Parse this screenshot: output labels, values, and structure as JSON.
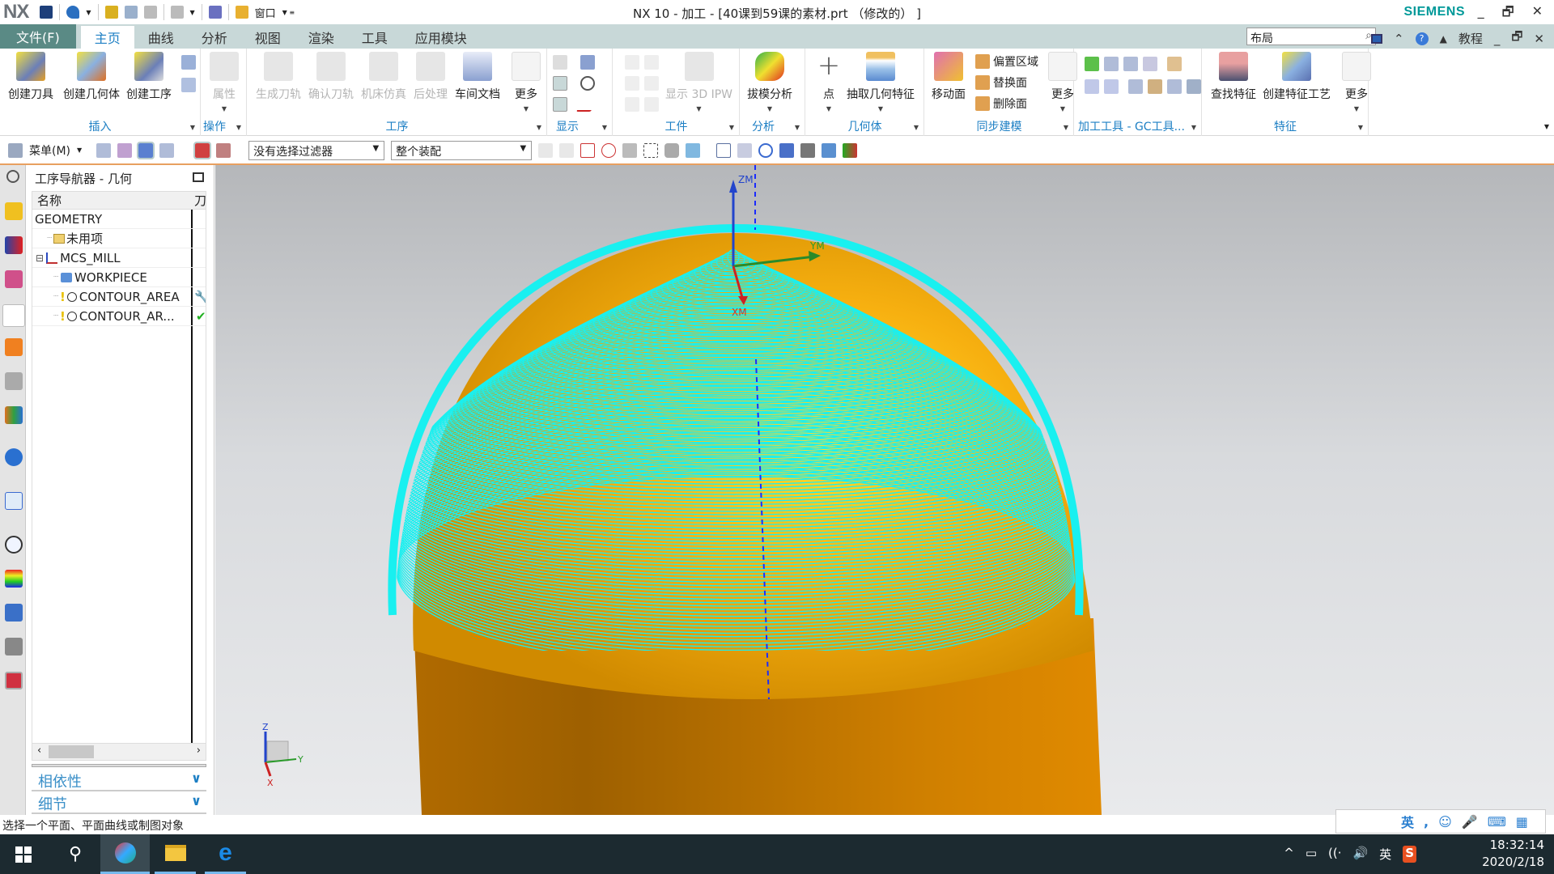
{
  "app": {
    "logo": "NX",
    "window_title": "NX 10 - 加工 - [40课到59课的素材.prt （修改的） ]",
    "brand": "SIEMENS",
    "quick_access": {
      "window_menu_label": "窗口"
    }
  },
  "window_controls": {
    "minimize": "_",
    "restore": "🗗",
    "close": "✕"
  },
  "tabs": {
    "file": "文件(F)",
    "items": [
      "主页",
      "曲线",
      "分析",
      "视图",
      "渲染",
      "工具",
      "应用模块"
    ],
    "active": "主页"
  },
  "command_search": {
    "value": "布局",
    "search_icon": "magnifier-icon"
  },
  "tab_right": {
    "help": "?",
    "tutorial": "教程"
  },
  "ribbon": {
    "groups": [
      {
        "label": "插入",
        "buttons": [
          "创建刀具",
          "创建几何体",
          "创建工序"
        ]
      },
      {
        "label": "操作",
        "buttons": [
          "属性"
        ]
      },
      {
        "label": "工序",
        "buttons": [
          "生成刀轨",
          "确认刀轨",
          "机床仿真",
          "后处理",
          "车间文档",
          "更多"
        ]
      },
      {
        "label": "显示",
        "buttons": []
      },
      {
        "label": "工件",
        "buttons": [
          "显示 3D IPW"
        ]
      },
      {
        "label": "分析",
        "buttons": [
          "拔模分析"
        ]
      },
      {
        "label": "几何体",
        "buttons": [
          "点",
          "抽取几何特征"
        ]
      },
      {
        "label": "同步建模",
        "buttons": [
          "移动面",
          "更多"
        ],
        "small_buttons": [
          "偏置区域",
          "替换面",
          "删除面"
        ]
      },
      {
        "label": "加工工具 - GC工具...",
        "buttons": []
      },
      {
        "label": "特征",
        "buttons": [
          "查找特征",
          "创建特征工艺",
          "更多"
        ]
      }
    ]
  },
  "toolbar2": {
    "menu_label": "菜单(M)",
    "filter_select": "没有选择过滤器",
    "assembly_select": "整个装配"
  },
  "navigator": {
    "title": "工序导航器 - 几何",
    "columns": [
      "名称",
      "刀"
    ],
    "rows": [
      {
        "name": "GEOMETRY",
        "level": 0,
        "icon": "",
        "status": ""
      },
      {
        "name": "未用项",
        "level": 1,
        "icon": "unused-folder-icon",
        "status": ""
      },
      {
        "name": "MCS_MILL",
        "level": 1,
        "icon": "mcs-axes-icon",
        "status": "",
        "expanded": true
      },
      {
        "name": "WORKPIECE",
        "level": 2,
        "icon": "workpiece-icon",
        "status": ""
      },
      {
        "name": "CONTOUR_AREA",
        "level": 2,
        "icon": "contour-operation-icon",
        "status": "wrench",
        "warning": "!"
      },
      {
        "name": "CONTOUR_AR...",
        "level": 2,
        "icon": "contour-operation-icon",
        "status": "check",
        "warning": "!"
      }
    ],
    "sections": [
      "相依性",
      "细节"
    ]
  },
  "viewport": {
    "csys_labels": {
      "z": "ZM",
      "y": "YM",
      "x": "XM"
    },
    "triad_labels": {
      "z": "Z",
      "y": "Y",
      "x": "X"
    },
    "colors": {
      "toolpath": "#19f0f0",
      "part": "#f5a50a",
      "body": "#c07800"
    }
  },
  "status_bar": {
    "prompt": "选择一个平面、平面曲线或制图对象"
  },
  "ime_bar": {
    "lang": "英"
  },
  "taskbar": {
    "time": "18:32:14",
    "date": "2020/2/18",
    "tray_lang": "英"
  }
}
